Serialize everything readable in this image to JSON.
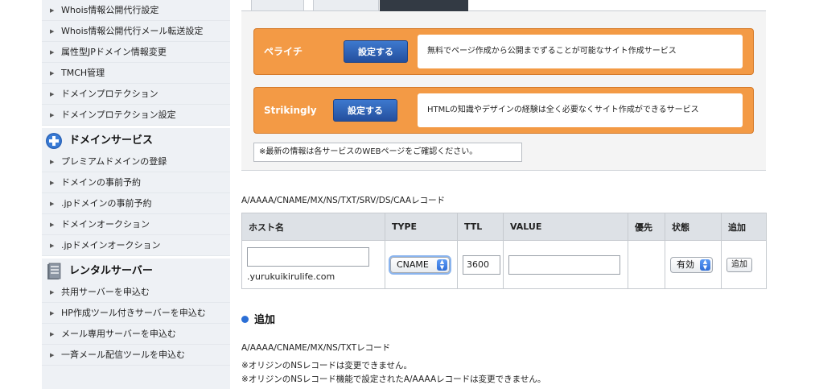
{
  "sidebar": {
    "group1": [
      {
        "label": "Whois情報公開代行設定"
      },
      {
        "label": "Whois情報公開代行メール転送設定"
      },
      {
        "label": "属性型JPドメイン情報変更"
      },
      {
        "label": "TMCH管理"
      },
      {
        "label": "ドメインプロテクション"
      },
      {
        "label": "ドメインプロテクション設定"
      }
    ],
    "domain_service": {
      "title": "ドメインサービス",
      "icon": "plus-circle-icon",
      "items": [
        {
          "label": "プレミアムドメインの登録"
        },
        {
          "label": "ドメインの事前予約"
        },
        {
          "label": ".jpドメインの事前予約"
        },
        {
          "label": "ドメインオークション"
        },
        {
          "label": ".jpドメインオークション"
        }
      ]
    },
    "rental_server": {
      "title": "レンタルサーバー",
      "icon": "server-icon",
      "items": [
        {
          "label": "共用サーバーを申込む"
        },
        {
          "label": "HP作成ツール付きサーバーを申込む"
        },
        {
          "label": "メール専用サーバーを申込む"
        },
        {
          "label": "一斉メール配信ツールを申込む"
        }
      ]
    }
  },
  "site_builders": [
    {
      "name": "ペライチ",
      "button": "設定する",
      "description": "無料でページ作成から公開までずることが可能なサイト作成サービス"
    },
    {
      "name": "Strikingly",
      "button": "設定する",
      "description": "HTMLの知識やデザインの経験は全く必要なくサイト作成ができるサービス"
    }
  ],
  "notice": "※最新の情報は各サービスのWEBページをご確認ください。",
  "records": {
    "caption": "A/AAAA/CNAME/MX/NS/TXT/SRV/DS/CAAレコード",
    "columns": [
      "ホスト名",
      "TYPE",
      "TTL",
      "VALUE",
      "優先",
      "状態",
      "追加"
    ],
    "row": {
      "host_value": "",
      "host_suffix": ".yurukuikirulife.com",
      "type": "CNAME",
      "ttl": "3600",
      "value": "",
      "priority": "",
      "status": "有効",
      "add_button": "追加"
    }
  },
  "add_section": {
    "title": "追加",
    "caption": "A/AAAA/CNAME/MX/NS/TXTレコード",
    "notes": [
      "※オリジンのNSレコードは変更できません。",
      "※オリジンのNSレコード機能で設定されたA/AAAAレコードは変更できません。"
    ]
  },
  "colors": {
    "builder_orange": "#f39a45",
    "button_blue": "#2f65bd",
    "sidebar_bg": "#eef1f5",
    "table_header": "#dde1e6"
  }
}
